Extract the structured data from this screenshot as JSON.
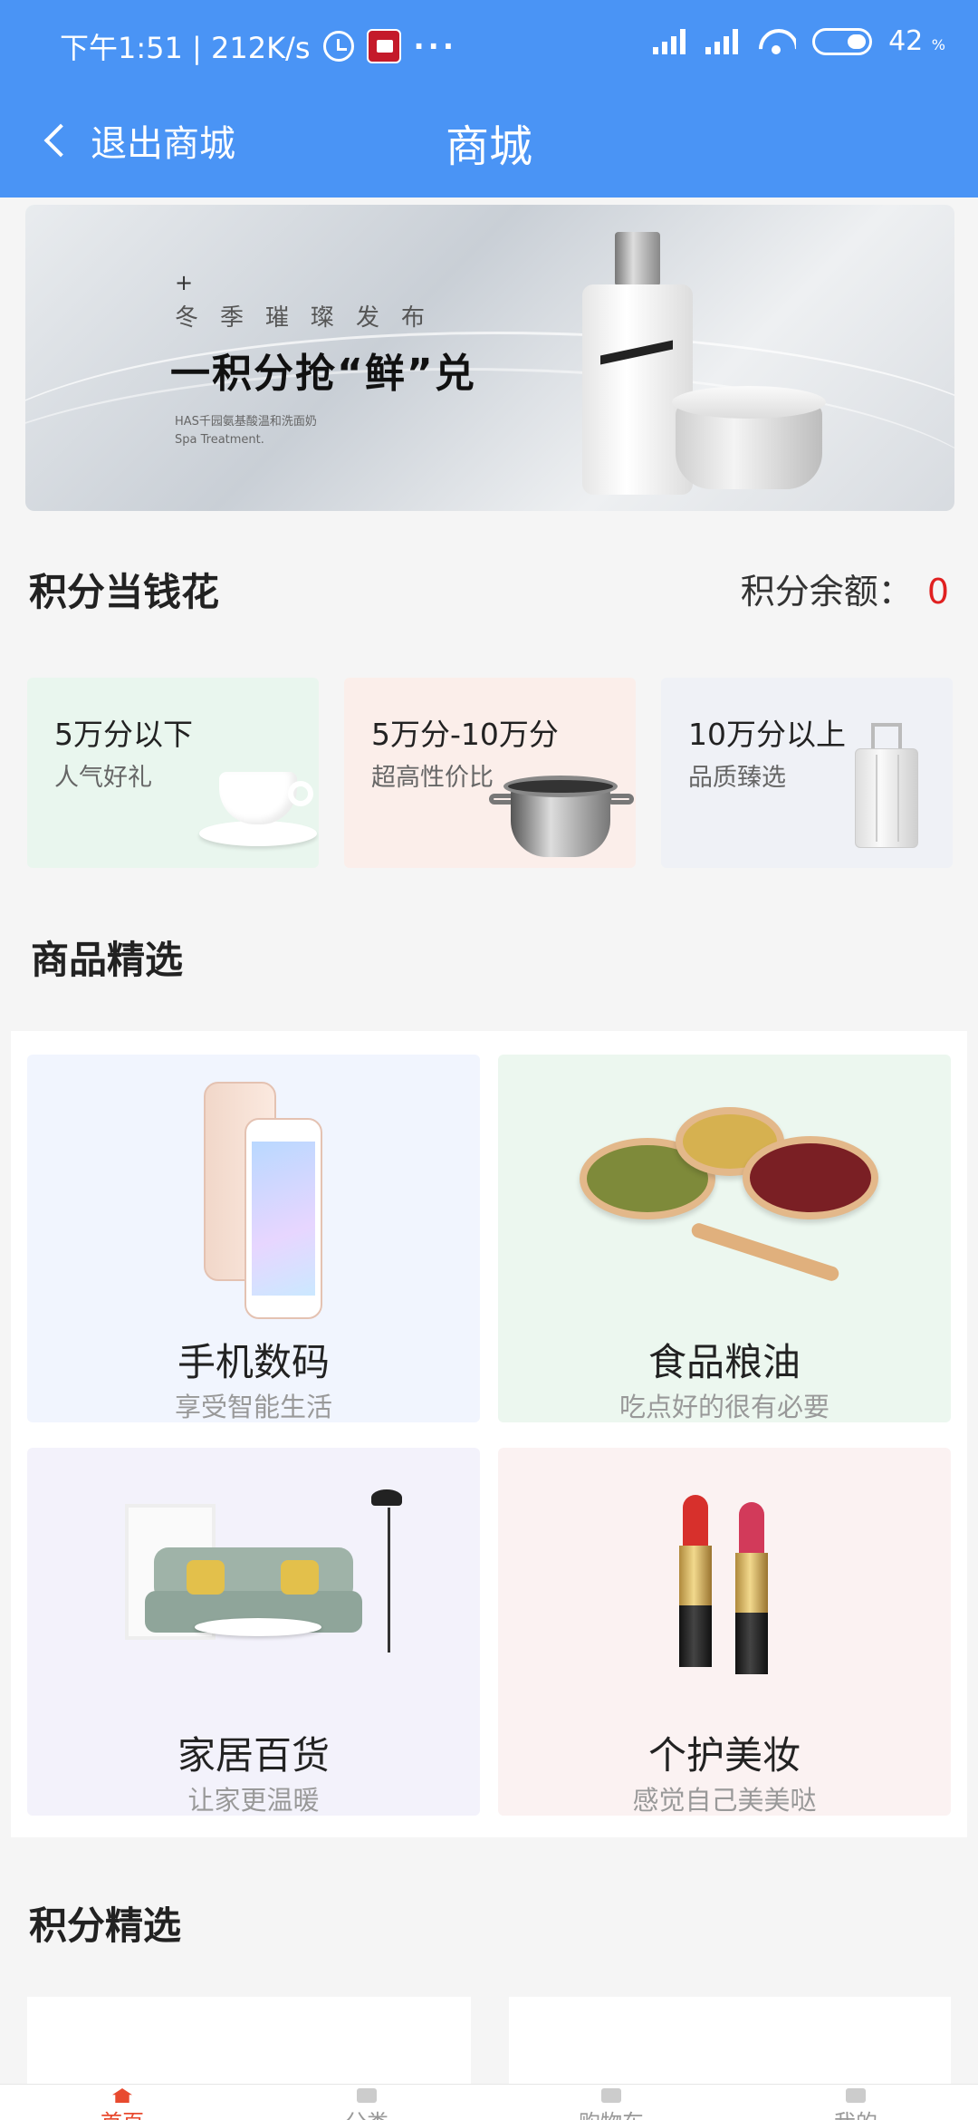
{
  "status_bar": {
    "time_speed": "下午1:51 | 212K/s",
    "more": "···",
    "battery": "42",
    "battery_unit": "%"
  },
  "header": {
    "back_label": "退出商城",
    "title": "商城"
  },
  "banner": {
    "plus": "+",
    "subtitle": "冬季璀璨发布",
    "headline": "一积分抢“鲜”兑",
    "small_line1": "HAS千园氨基酸温和洗面奶",
    "small_line2": "Spa Treatment."
  },
  "points_section": {
    "title": "积分当钱花",
    "balance_label": "积分余额：",
    "balance_value": "0",
    "tiers": [
      {
        "title": "5万分以下",
        "subtitle": "人气好礼",
        "bg": "#e9f6ee"
      },
      {
        "title": "5万分-10万分",
        "subtitle": "超高性价比",
        "bg": "#fbeeea"
      },
      {
        "title": "10万分以上",
        "subtitle": "品质臻选",
        "bg": "#eff1f6"
      }
    ]
  },
  "featured_section": {
    "title": "商品精选",
    "categories": [
      {
        "name": "手机数码",
        "desc": "享受智能生活",
        "bg": "#f1f5fe"
      },
      {
        "name": "食品粮油",
        "desc": "吃点好的很有必要",
        "bg": "#ecf7ef"
      },
      {
        "name": "家居百货",
        "desc": "让家更温暖",
        "bg": "#f3f2fb"
      },
      {
        "name": "个护美妆",
        "desc": "感觉自己美美哒",
        "bg": "#fbf2f2"
      }
    ]
  },
  "points_picks": {
    "title": "积分精选"
  },
  "bottom_nav": [
    {
      "label": "首页",
      "active": true
    },
    {
      "label": "分类",
      "active": false
    },
    {
      "label": "购物车",
      "active": false
    },
    {
      "label": "我的",
      "active": false
    }
  ],
  "colors": {
    "header_bg": "#4a94f5",
    "accent_red": "#e02020",
    "nav_active": "#e84a2f"
  }
}
